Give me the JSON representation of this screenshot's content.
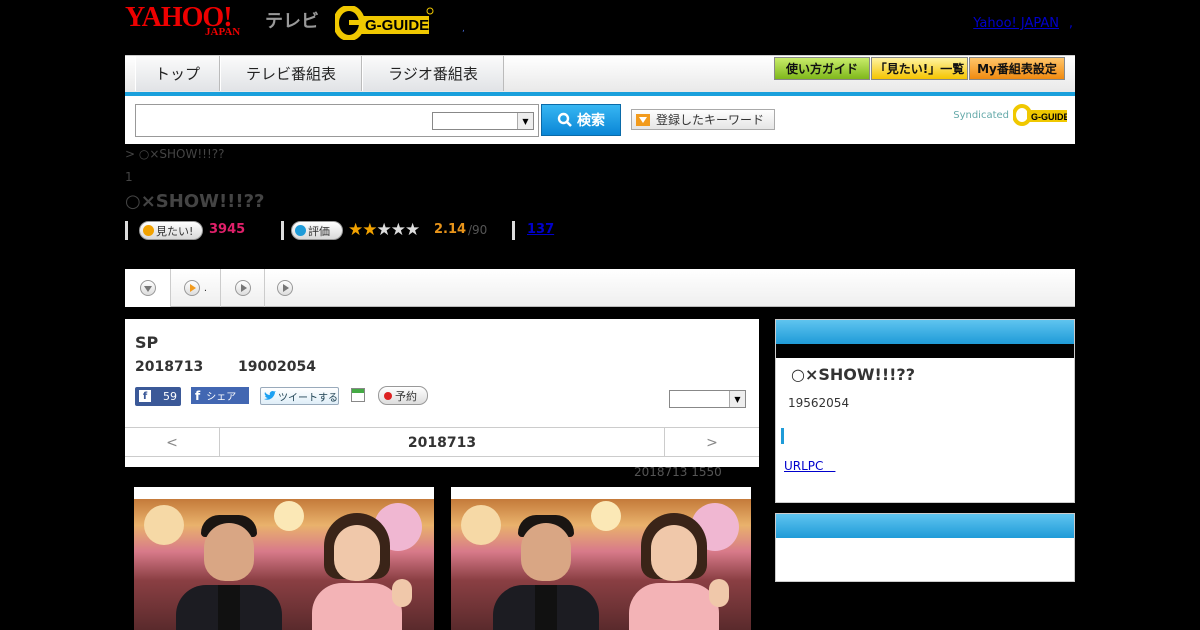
{
  "header": {
    "logo_yahoo": "YAHOO!",
    "logo_japan": "JAPAN",
    "logo_tv": "テレビ",
    "logo_gguide": "G-GUIDE",
    "yahoo_japan_link": "Yahoo! JAPAN",
    "link_separator": ",",
    "dot": ","
  },
  "nav": {
    "tabs": [
      {
        "label": "トップ"
      },
      {
        "label": "テレビ番組表"
      },
      {
        "label": "ラジオ番組表"
      }
    ],
    "guide_button": "使い方ガイド",
    "mitai_list_button": "「見たい!」一覧",
    "my_schedule_button": "My番組表設定"
  },
  "search": {
    "input_value": "",
    "select_value": "",
    "search_button": "検索",
    "keyword_button": "登録したキーワード",
    "syndicated_label": "Syndicated",
    "syndicated_logo": "G-GUIDE"
  },
  "breadcrumb": "> ○×SHOW!!!??",
  "page_number": "1",
  "show_title": "○×SHOW!!!??",
  "ratings": {
    "mitai_label": "見たい!",
    "mitai_count": "3945",
    "hyouka_label": "評価",
    "stars_filled": 2,
    "stars_total": 5,
    "score": "2.14",
    "score_total": "/90",
    "review_count": "137"
  },
  "subtabs": [
    {
      "label": ""
    },
    {
      "label": "."
    },
    {
      "label": ""
    },
    {
      "label": ""
    }
  ],
  "episode": {
    "title": "SP",
    "date": "2018713",
    "time": "19002054",
    "fb_count": "59",
    "fb_share_label": "シェア",
    "tweet_label": "ツイートする",
    "reserve_label": "予約",
    "select_value": "",
    "prev_label": "<",
    "current_day": "2018713",
    "next_label": ">",
    "updated": "2018713  1550"
  },
  "sidebar": {
    "show_title": "○×SHOW!!!??",
    "time": "19562054",
    "url_label": "URLPC　"
  },
  "colors": {
    "accent_blue": "#1f9bd8",
    "mitai_pink": "#e0206a",
    "score_orange": "#e8941a",
    "star_gold": "#f2a200"
  }
}
